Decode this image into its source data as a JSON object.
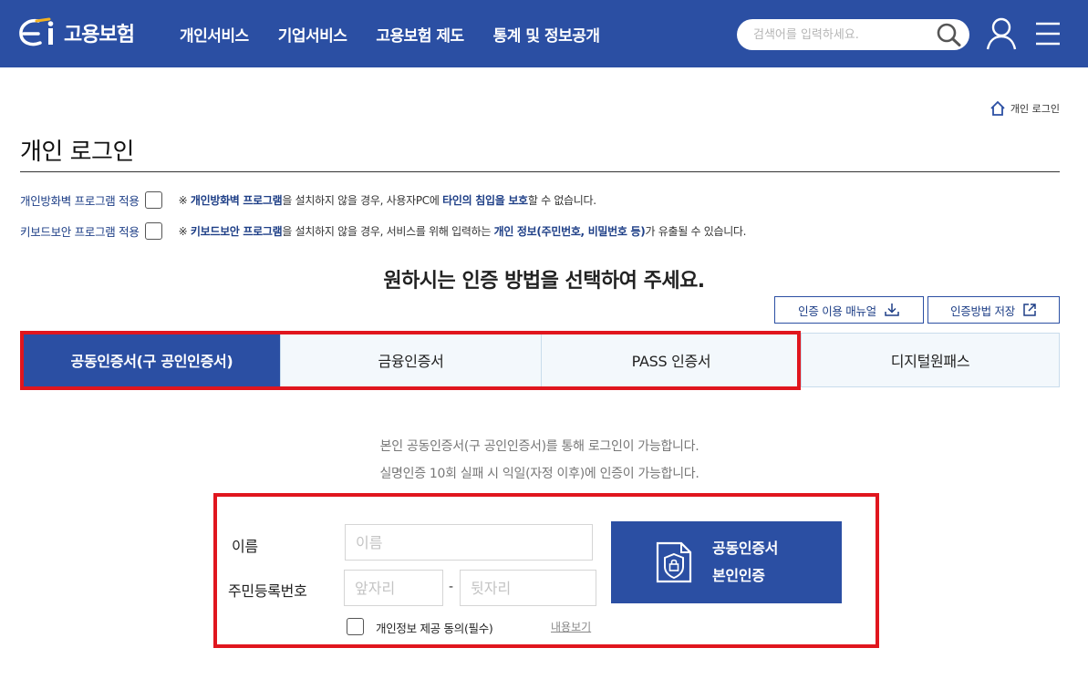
{
  "header": {
    "logo_text": "고용보험",
    "nav": [
      "개인서비스",
      "기업서비스",
      "고용보험 제도",
      "통계 및 정보공개"
    ],
    "search_placeholder": "검색어를 입력하세요.",
    "icons": [
      "search-icon",
      "user-icon",
      "menu-icon"
    ],
    "brand_color": "#2b4fa3"
  },
  "breadcrumb": {
    "current": "개인 로그인"
  },
  "page_title": "개인 로그인",
  "options": [
    {
      "label": "개인방화벽 프로그램 적용",
      "note": {
        "prefix": "※ ",
        "parts": [
          {
            "t": "개인방화벽 프로그램",
            "hl": true
          },
          {
            "t": "을 설치하지 않을 경우, 사용자PC에 ",
            "hl": false
          },
          {
            "t": "타인의 침입을 보호",
            "hl": true
          },
          {
            "t": "할 수 없습니다.",
            "hl": false
          }
        ]
      }
    },
    {
      "label": "키보드보안 프로그램 적용",
      "note": {
        "prefix": "※ ",
        "parts": [
          {
            "t": "키보드보안 프로그램",
            "hl": true
          },
          {
            "t": "을 설치하지 않을 경우, 서비스를 위해 입력하는 ",
            "hl": false
          },
          {
            "t": "개인 정보(주민번호, 비밀번호 등)",
            "hl": true
          },
          {
            "t": "가 유출될 수 있습니다.",
            "hl": false
          }
        ]
      }
    }
  ],
  "heading": "원하시는 인증 방법을 선택하여 주세요.",
  "buttons": {
    "manual": "인증 이용 매뉴얼",
    "save": "인증방법 저장"
  },
  "tabs": [
    {
      "label": "공동인증서(구 공인인증서)",
      "active": true
    },
    {
      "label": "금융인증서",
      "active": false
    },
    {
      "label": "PASS 인증서",
      "active": false
    },
    {
      "label": "디지털원패스",
      "active": false
    }
  ],
  "info": [
    "본인 공동인증서(구 공인인증서)를 통해 로그인이 가능합니다.",
    "실명인증 10회 실패 시 익일(자정 이후)에 인증이 가능합니다."
  ],
  "form": {
    "name_label": "이름",
    "name_placeholder": "이름",
    "rrn_label": "주민등록번호",
    "rrn_front_placeholder": "앞자리",
    "rrn_separator": "-",
    "rrn_back_placeholder": "뒷자리",
    "cert_button_line1": "공동인증서",
    "cert_button_line2": "본인인증",
    "agree_label": "개인정보 제공 동의(필수)",
    "view_link": "내용보기"
  },
  "highlight_color": "#e0161e"
}
